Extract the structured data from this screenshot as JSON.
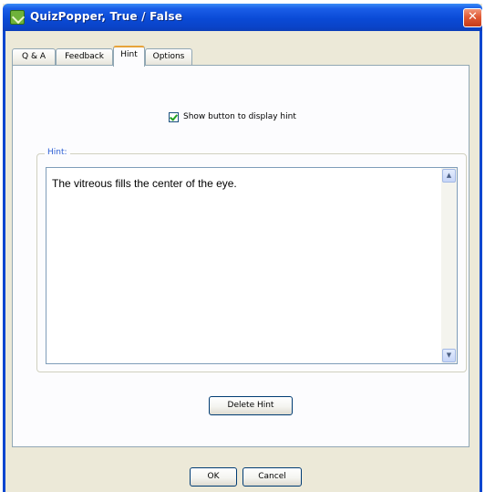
{
  "window": {
    "title": "QuizPopper, True / False",
    "close_glyph": "✕"
  },
  "tabs": [
    {
      "label": "Q & A",
      "active": false
    },
    {
      "label": "Feedback",
      "active": false
    },
    {
      "label": "Hint",
      "active": true
    },
    {
      "label": "Options",
      "active": false
    }
  ],
  "hint_panel": {
    "show_button_checkbox": {
      "label": "Show button to display hint",
      "checked": true
    },
    "group_label": "Hint:",
    "hint_text": "The vitreous fills the center of the eye.",
    "delete_button": "Delete Hint"
  },
  "footer": {
    "ok_label": "OK",
    "cancel_label": "Cancel"
  },
  "colors": {
    "titlebar": "#0a4ad6",
    "accent_tab": "#e7a33a",
    "group_label": "#2d5fd4",
    "checkmark": "#21a121"
  }
}
